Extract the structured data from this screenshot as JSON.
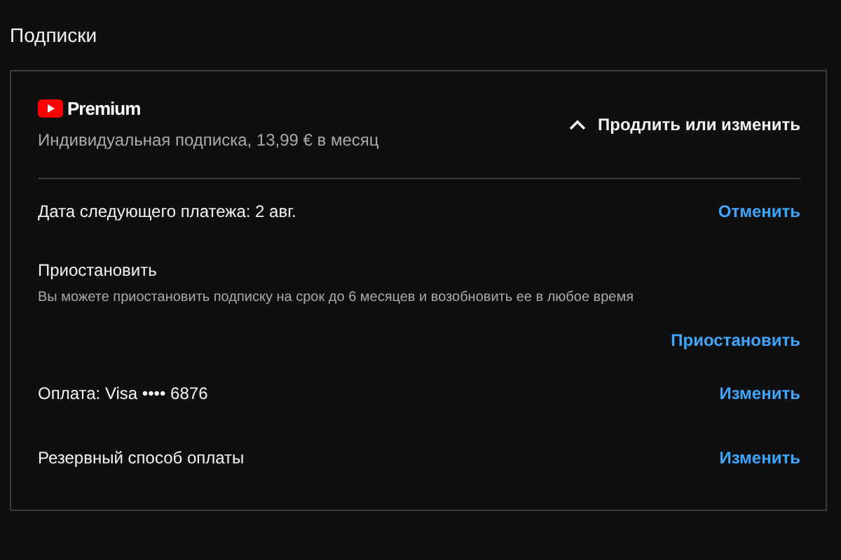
{
  "page_title": "Подписки",
  "subscription": {
    "brand": "Premium",
    "plan": "Индивидуальная подписка, 13,99 € в месяц",
    "toggle": {
      "label": "Продлить или изменить",
      "expanded": true
    }
  },
  "rows": [
    {
      "kind": "line",
      "label": "Дата следующего платежа: 2 авг.",
      "action": "Отменить"
    },
    {
      "kind": "block",
      "label": "Приостановить",
      "description": "Вы можете приостановить подписку на срок до 6 месяцев и возобновить ее в любое время",
      "action": "Приостановить"
    },
    {
      "kind": "line",
      "label": "Оплата: Visa •••• 6876",
      "action": "Изменить"
    },
    {
      "kind": "line",
      "label": "Резервный способ оплаты",
      "action": "Изменить"
    }
  ]
}
